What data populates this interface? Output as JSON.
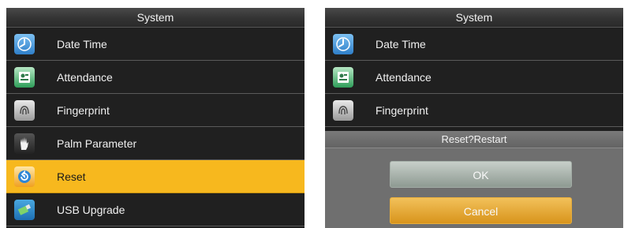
{
  "left_screen": {
    "title": "System",
    "items": [
      {
        "label": "Date Time",
        "icon": "clock-icon"
      },
      {
        "label": "Attendance",
        "icon": "attendance-icon"
      },
      {
        "label": "Fingerprint",
        "icon": "fingerprint-icon"
      },
      {
        "label": "Palm Parameter",
        "icon": "palm-icon"
      },
      {
        "label": "Reset",
        "icon": "reset-icon",
        "selected": true
      },
      {
        "label": "USB Upgrade",
        "icon": "usb-icon"
      }
    ]
  },
  "right_screen": {
    "title": "System",
    "items": [
      {
        "label": "Date Time",
        "icon": "clock-icon"
      },
      {
        "label": "Attendance",
        "icon": "attendance-icon"
      },
      {
        "label": "Fingerprint",
        "icon": "fingerprint-icon"
      }
    ],
    "dialog": {
      "title": "Reset?Restart",
      "ok_label": "OK",
      "cancel_label": "Cancel"
    }
  },
  "colors": {
    "selected_bg": "#f7b81e",
    "background": "#202020",
    "cancel_button": "#e0a030",
    "ok_button": "#aab4ad"
  }
}
